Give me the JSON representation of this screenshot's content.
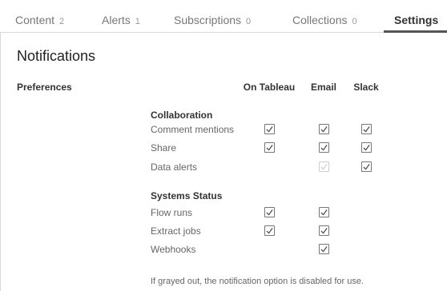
{
  "tabs": [
    {
      "label": "Content",
      "count": "2"
    },
    {
      "label": "Alerts",
      "count": "1"
    },
    {
      "label": "Subscriptions",
      "count": "0"
    },
    {
      "label": "Collections",
      "count": "0"
    },
    {
      "label": "Settings",
      "count": ""
    }
  ],
  "active_tab": "Settings",
  "page": {
    "heading": "Notifications",
    "preferences_label": "Preferences",
    "columns": [
      "On Tableau",
      "Email",
      "Slack"
    ],
    "footer_note": "If grayed out, the notification option is disabled for use."
  },
  "sections": [
    {
      "title": "Collaboration",
      "rows": [
        {
          "label": "Comment mentions",
          "on_tableau": "checked",
          "email": "checked",
          "slack": "checked"
        },
        {
          "label": "Share",
          "on_tableau": "checked",
          "email": "checked",
          "slack": "checked"
        },
        {
          "label": "Data alerts",
          "on_tableau": "none",
          "email": "disabled-checked",
          "slack": "checked"
        }
      ]
    },
    {
      "title": "Systems Status",
      "rows": [
        {
          "label": "Flow runs",
          "on_tableau": "checked",
          "email": "checked",
          "slack": "none"
        },
        {
          "label": "Extract jobs",
          "on_tableau": "checked",
          "email": "checked",
          "slack": "none"
        },
        {
          "label": "Webhooks",
          "on_tableau": "none",
          "email": "checked",
          "slack": "none"
        }
      ]
    }
  ],
  "colors": {
    "active_underline": "#555555",
    "checkmark": "#444444",
    "disabled": "#cfcfcf"
  },
  "icons": {
    "checkbox": "checkmark-icon"
  }
}
